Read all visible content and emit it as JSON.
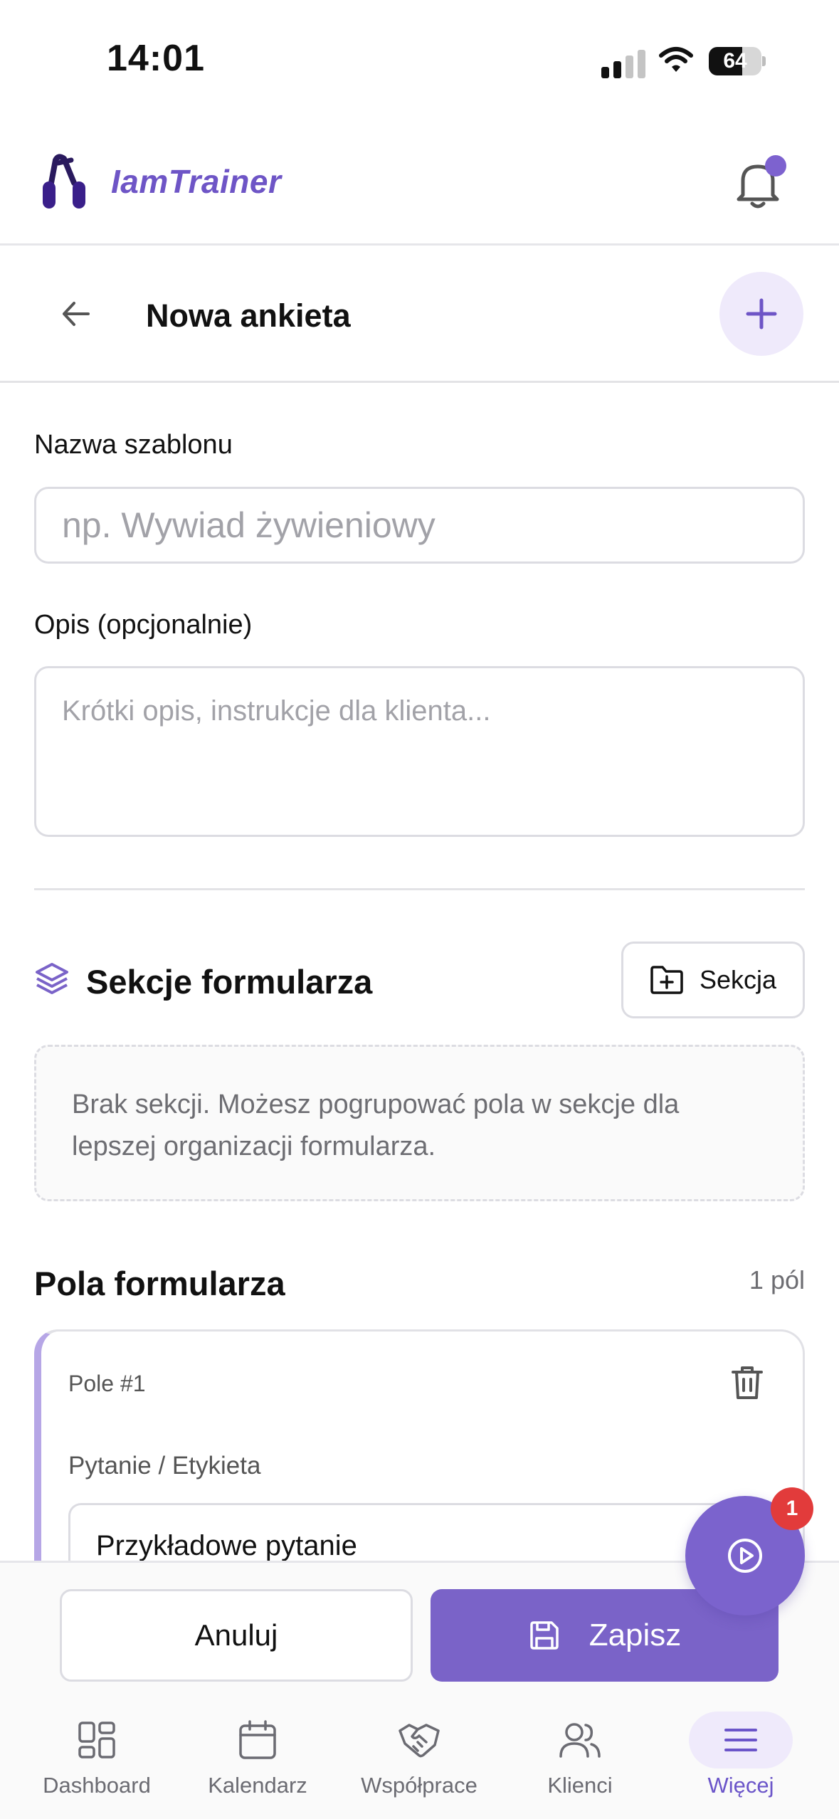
{
  "status_bar": {
    "time": "14:01",
    "battery": "64"
  },
  "header": {
    "brand": "IamTrainer",
    "notification_dot": true
  },
  "page": {
    "title": "Nowa ankieta"
  },
  "form": {
    "name_label": "Nazwa szablonu",
    "name_placeholder": "np. Wywiad żywieniowy",
    "description_label": "Opis (opcjonalnie)",
    "description_placeholder": "Krótki opis, instrukcje dla klienta..."
  },
  "sections": {
    "title": "Sekcje formularza",
    "add_button": "Sekcja",
    "empty_text": "Brak sekcji. Możesz pogrupować pola w sekcje dla lepszej organizacji formularza."
  },
  "fields": {
    "title": "Pola formularza",
    "count": "1 pól",
    "items": [
      {
        "number": "Pole #1",
        "question_label": "Pytanie / Etykieta",
        "question_value": "Przykładowe pytanie"
      }
    ]
  },
  "fab": {
    "badge": "1"
  },
  "actions": {
    "cancel": "Anuluj",
    "save": "Zapisz"
  },
  "tabbar": {
    "items": [
      {
        "label": "Dashboard",
        "icon": "dashboard-icon"
      },
      {
        "label": "Kalendarz",
        "icon": "calendar-icon"
      },
      {
        "label": "Współprace",
        "icon": "handshake-icon"
      },
      {
        "label": "Klienci",
        "icon": "users-icon"
      },
      {
        "label": "Więcej",
        "icon": "menu-icon",
        "active": true
      }
    ]
  },
  "colors": {
    "accent": "#7a63c8",
    "accent_light": "#efeafb",
    "badge": "#e23b3b"
  }
}
